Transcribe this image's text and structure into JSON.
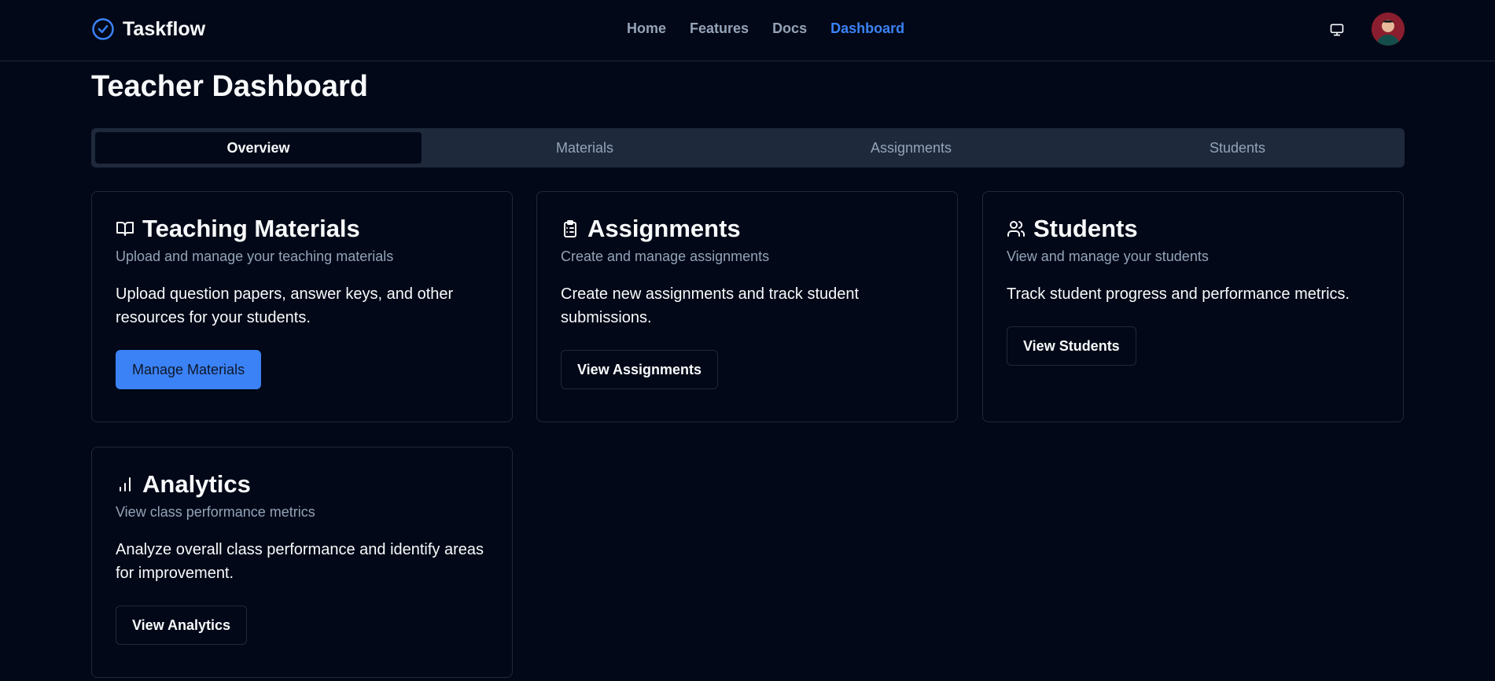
{
  "app": {
    "name": "Taskflow"
  },
  "nav": {
    "links": [
      {
        "label": "Home"
      },
      {
        "label": "Features"
      },
      {
        "label": "Docs"
      },
      {
        "label": "Dashboard",
        "active": true
      }
    ]
  },
  "page": {
    "title": "Teacher Dashboard"
  },
  "tabs": [
    {
      "label": "Overview",
      "active": true
    },
    {
      "label": "Materials"
    },
    {
      "label": "Assignments"
    },
    {
      "label": "Students"
    }
  ],
  "cards": [
    {
      "icon": "book-open-icon",
      "title": "Teaching Materials",
      "subtitle": "Upload and manage your teaching materials",
      "body": "Upload question papers, answer keys, and other resources for your students.",
      "button": "Manage Materials"
    },
    {
      "icon": "clipboard-list-icon",
      "title": "Assignments",
      "subtitle": "Create and manage assignments",
      "body": "Create new assignments and track student submissions.",
      "button": "View Assignments"
    },
    {
      "icon": "users-icon",
      "title": "Students",
      "subtitle": "View and manage your students",
      "body": "Track student progress and performance metrics.",
      "button": "View Students"
    },
    {
      "icon": "bar-chart-icon",
      "title": "Analytics",
      "subtitle": "View class performance metrics",
      "body": "Analyze overall class performance and identify areas for improvement.",
      "button": "View Analytics"
    }
  ],
  "colors": {
    "background": "#020817",
    "accent": "#3b82f6",
    "border": "#1e293b",
    "muted_text": "#94a3b8"
  }
}
